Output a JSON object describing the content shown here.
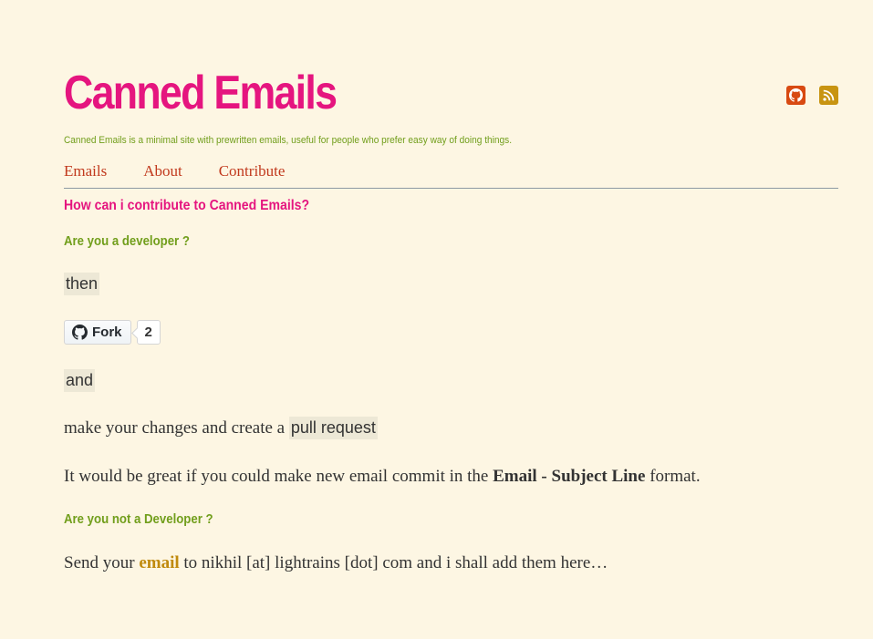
{
  "header": {
    "title": "Canned Emails",
    "tagline": "Canned Emails is a minimal site with prewritten emails, useful for people who prefer easy way of doing things.",
    "icons": [
      "github-icon",
      "rss-icon"
    ]
  },
  "nav": {
    "items": [
      {
        "label": "Emails"
      },
      {
        "label": "About"
      },
      {
        "label": "Contribute"
      }
    ]
  },
  "content": {
    "heading": "How can i contribute to Canned Emails?",
    "developer_heading": "Are you a developer ?",
    "then_text": "then",
    "fork": {
      "label": "Fork",
      "count": "2"
    },
    "and_text": "and",
    "changes_prefix": "make your changes and create a",
    "pull_request": "pull request",
    "commit_prefix": "It would be great if you could make new email commit in the",
    "commit_format": "Email - Subject Line",
    "commit_suffix": "format.",
    "non_dev_heading": "Are you not a Developer ?",
    "send_prefix": "Send your",
    "email_link": "email",
    "send_suffix": "to nikhil [at] lightrains [dot] com and i shall add them here…"
  },
  "colors": {
    "background": "#fdf6e3",
    "title": "#e5157f",
    "green": "#719e1b",
    "nav": "#c1391d",
    "link": "#c08a0d"
  }
}
